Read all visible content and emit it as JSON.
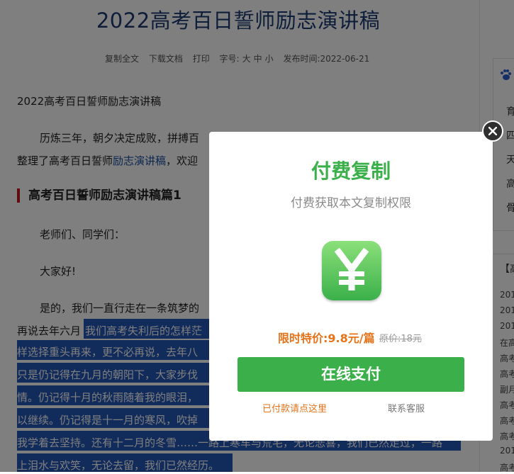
{
  "article": {
    "title": "2022高考百日誓师励志演讲稿",
    "meta": {
      "copy_all": "复制全文",
      "download": "下载文档",
      "print": "打印",
      "font_label": "字号:",
      "font_large": "大",
      "font_medium": "中",
      "font_small": "小",
      "publish_time": "发布时间:2022-06-21"
    },
    "lead": "2022高考百日誓师励志演讲稿",
    "para1_line1": "历炼三年，朝夕决定成败，拼搏百",
    "para1_line2_a": "整理了高考百日誓师",
    "para1_line2_link": "励志演讲稿",
    "para1_line2_b": "，欢迎",
    "section_heading": "高考百日誓师励志演讲稿篇1",
    "greeting": "老师们、同学们：",
    "hello": "大家好!",
    "para2_line1": "是的，我们一直行走在一条筑梦的",
    "para2_line2_a": "再说去年六月",
    "para2_line2_b": "我们高考失利后的怎样茫",
    "hl_line3": "样选择重头再来，更不必再说，去年八",
    "hl_line4": "只是仍记得在九月的朝阳下，大家步伐",
    "hl_line5": "情。仍记得十月的秋雨随着我的眼泪，",
    "hl_line6": "以继续。仍记得是十一月的寒风，吹掉",
    "hl_line7": "我学着去坚持。还有十二月的冬雪……一路上寒车与荒宅，无论悲喜，我们已然走过，一路",
    "hl_line8": "上泪水与欢笑，无论去留，我们已然经历。"
  },
  "sidebar": {
    "items": [
      "育",
      "四",
      "天",
      "高",
      "骨"
    ],
    "list_header": "【高",
    "list": [
      "201",
      "201",
      "201",
      "在高",
      "高考",
      "高考",
      "副月",
      "高考",
      "高考",
      "高考",
      "201",
      "高考"
    ]
  },
  "modal": {
    "title": "付费复制",
    "subtitle": "付费获取本文复制权限",
    "icon": "yen-icon",
    "price_label": "限时特价:9.8元/篇",
    "original_price": "原价:18元",
    "pay_button": "在线支付",
    "paid_link": "已付款请点这里",
    "service_link": "联系客服"
  },
  "colors": {
    "green": "#3bb04a",
    "orange": "#e6731a",
    "highlight": "#2356b6",
    "title_blue": "#1c3b73"
  }
}
